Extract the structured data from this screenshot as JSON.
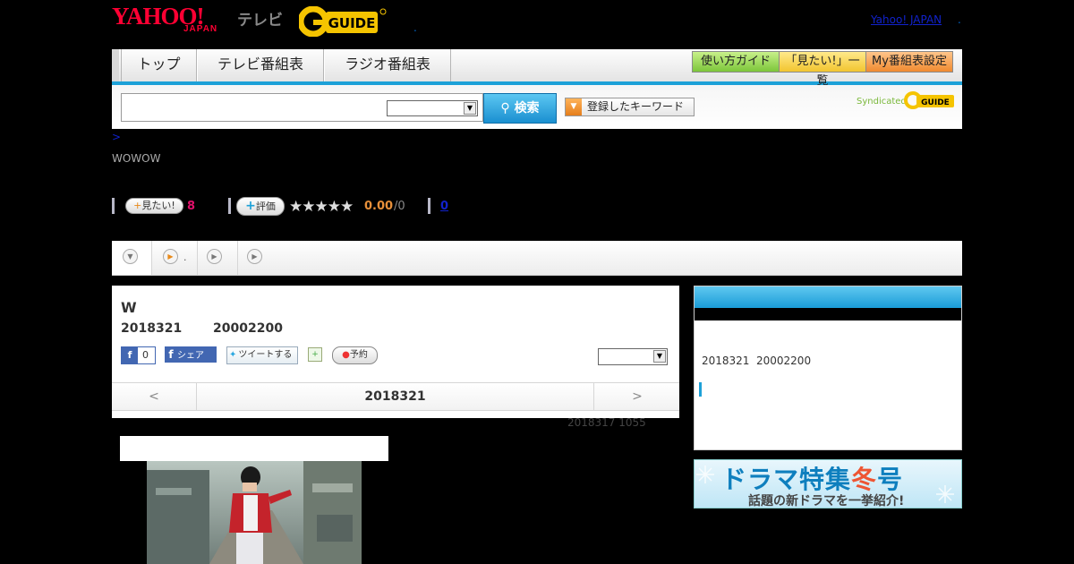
{
  "header": {
    "logo_yahoo": "YAHOO!",
    "logo_japan": "JAPAN",
    "logo_tv": "テレビ",
    "gguide_logo": "GUIDE",
    "dot": ".",
    "yahoo_japan_link": "Yahoo! JAPAN",
    "dot2": "."
  },
  "nav": {
    "tabs": [
      {
        "label": "トップ"
      },
      {
        "label": "テレビ番組表"
      },
      {
        "label": "ラジオ番組表"
      }
    ],
    "buttons": {
      "guide": "使い方ガイド",
      "mitai_list": "「見たい!」一覧",
      "my_settings": "My番組表設定"
    }
  },
  "search": {
    "query": "",
    "select_value": "",
    "button_label": "検索",
    "keyword_button_label": "登録したキーワード",
    "syndicated": "Syndicated"
  },
  "breadcrumb": ">",
  "channel": "WOWOW",
  "stats": {
    "mitai_label": "見たい!",
    "mitai_count": "8",
    "hyoka_label": "評価",
    "stars": "★★★★★",
    "rating": "0.00",
    "rating_count": "/0",
    "review_count": "0"
  },
  "subtabs": {
    "tab2_dot": "."
  },
  "program": {
    "title": "W",
    "date": "2018321",
    "time": "20002200",
    "fb_like_count": "0",
    "fb_share_label": "シェア",
    "tweet_label": "ツイートする",
    "yoyaku_label": "予約",
    "select_value": ""
  },
  "date_nav": {
    "prev": "<",
    "current": "2018321",
    "next": ">"
  },
  "update_info": "2018317  1055",
  "side": {
    "date": "2018321",
    "time": "20002200"
  },
  "banner": {
    "line1a": "ドラマ特集",
    "line1b": "冬",
    "line1c": "号",
    "line2": "話題の新ドラマを一挙紹介!"
  },
  "colors": {
    "accent_blue": "#1da1d8",
    "yahoo_red": "#ff0033",
    "mitai_pink": "#e0106a",
    "rating_orange": "#e8903a"
  }
}
